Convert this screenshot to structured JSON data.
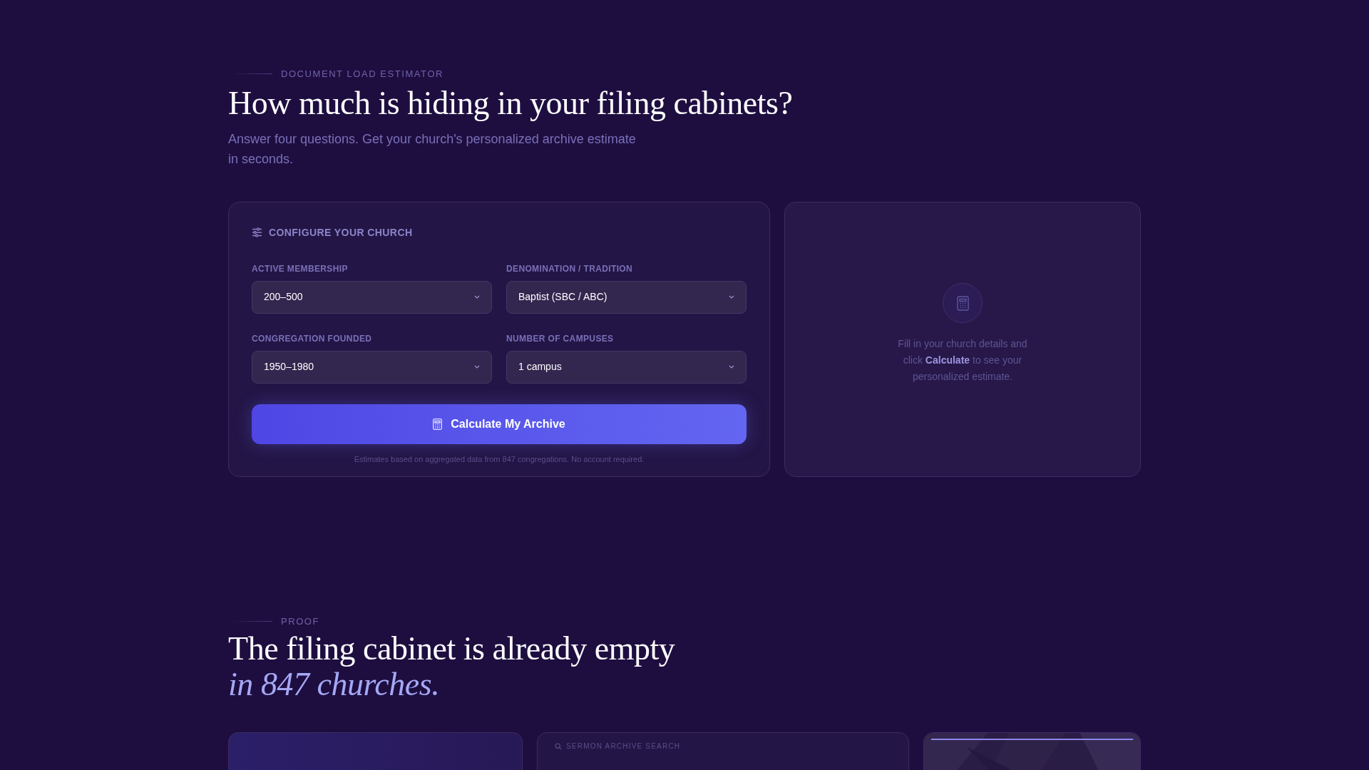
{
  "eyebrow": "DOCUMENT LOAD ESTIMATOR",
  "heading": "How much is hiding in your filing cabinets?",
  "subtitle": "Answer four questions. Get your church's personalized archive estimate in seconds.",
  "config_card": {
    "title": "CONFIGURE YOUR CHURCH",
    "fields": [
      {
        "label": "ACTIVE MEMBERSHIP",
        "value": "200–500"
      },
      {
        "label": "DENOMINATION / TRADITION",
        "value": "Baptist (SBC / ABC)"
      },
      {
        "label": "CONGREGATION FOUNDED",
        "value": "1950–1980"
      },
      {
        "label": "NUMBER OF CAMPUSES",
        "value": "1 campus"
      }
    ],
    "button": "Calculate My Archive",
    "footnote": "Estimates based on aggregated data from 847 congregations. No account required."
  },
  "result_card": {
    "message": "Fill in your church details and click **Calculate** to see your personalized estimate."
  },
  "proof": {
    "eyebrow": "PROOF",
    "heading": "The filing cabinet is already empty",
    "heading_emphasis": "in 847 churches.",
    "cards": [
      {
        "kind": "gradient"
      },
      {
        "kind": "feature",
        "label": "SERMON ARCHIVE SEARCH"
      },
      {
        "kind": "picture"
      }
    ]
  }
}
